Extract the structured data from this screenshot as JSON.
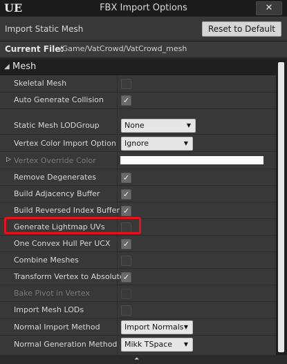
{
  "window": {
    "title": "FBX Import Options",
    "logo": "UE",
    "close_glyph": "✕"
  },
  "header": {
    "label": "Import Static Mesh",
    "reset_label": "Reset to Default"
  },
  "file": {
    "label": "Current File:",
    "value": "/Game/VatCrowd/VatCrowd_mesh"
  },
  "section": {
    "title": "Mesh",
    "arrow": "◢"
  },
  "rows": [
    {
      "label": "Skeletal Mesh",
      "checked": false
    },
    {
      "label": "Auto Generate Collision",
      "checked": true
    },
    {
      "label": "Static Mesh LODGroup",
      "value": "None"
    },
    {
      "label": "Vertex Color Import Option",
      "value": "Ignore"
    },
    {
      "label": "Vertex Override Color",
      "color": "#ffffff",
      "disabled": true
    },
    {
      "label": "Remove Degenerates",
      "checked": true
    },
    {
      "label": "Build Adjacency Buffer",
      "checked": true
    },
    {
      "label": "Build Reversed Index Buffer",
      "checked": true
    },
    {
      "label": "Generate Lightmap UVs",
      "checked": false,
      "highlighted": true
    },
    {
      "label": "One Convex Hull Per UCX",
      "checked": true
    },
    {
      "label": "Combine Meshes",
      "checked": false
    },
    {
      "label": "Transform Vertex to Absolute",
      "checked": true
    },
    {
      "label": "Bake Pivot in Vertex",
      "checked": false,
      "disabled": true
    },
    {
      "label": "Import Mesh LODs",
      "checked": false
    },
    {
      "label": "Normal Import Method",
      "value": "Import Normals"
    },
    {
      "label": "Normal Generation Method",
      "value": "Mikk TSpace"
    }
  ],
  "icons": {
    "check": "✓",
    "dropdown": "▼",
    "expand": "▷",
    "grip": "⏶"
  },
  "colors": {
    "highlight": "#e8101a",
    "background": "#383838"
  }
}
